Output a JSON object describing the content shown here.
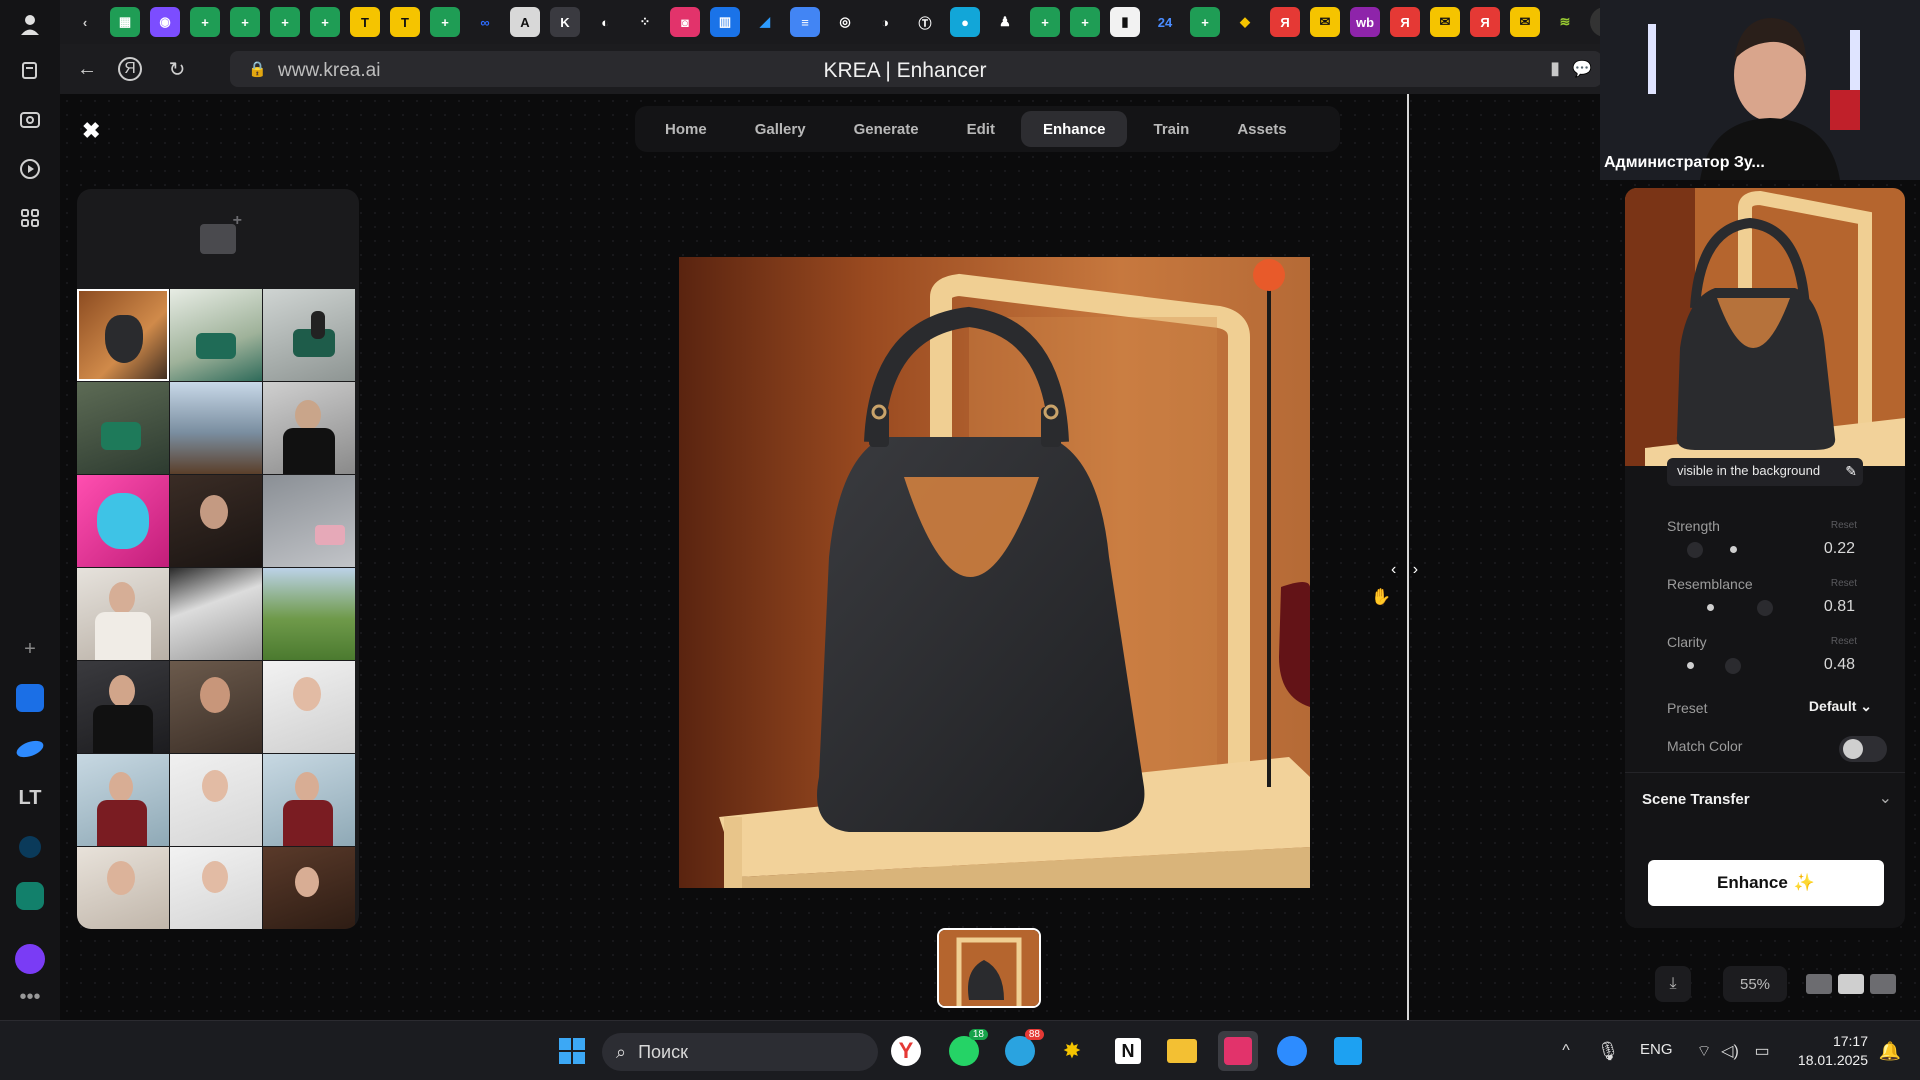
{
  "browser": {
    "url": "www.krea.ai",
    "page_title": "KREA | Enhancer"
  },
  "krea": {
    "nav": [
      "Home",
      "Gallery",
      "Generate",
      "Edit",
      "Enhance",
      "Train",
      "Assets"
    ],
    "active_nav": "Enhance"
  },
  "settings": {
    "prompt_snippet": "visible in the background",
    "reset_label": "Reset",
    "strength": {
      "label": "Strength",
      "value": "0.22"
    },
    "resemblance": {
      "label": "Resemblance",
      "value": "0.81"
    },
    "clarity": {
      "label": "Clarity",
      "value": "0.48"
    },
    "preset": {
      "label": "Preset",
      "value": "Default"
    },
    "match_color": {
      "label": "Match Color",
      "enabled": false
    },
    "scene_transfer": "Scene Transfer",
    "enhance_button": "Enhance"
  },
  "toolbar": {
    "zoom": "55%"
  },
  "webcam": {
    "name": "Администратор Зу..."
  },
  "taskbar": {
    "search_placeholder": "Поиск",
    "language": "ENG",
    "time": "17:17",
    "date": "18.01.2025",
    "whatsapp_badge": "18",
    "telegram_badge": "88"
  },
  "colors": {
    "accent_white": "#ffffff",
    "panel": "#141416",
    "bag": "#2a2b2e",
    "shelf": "#f2d29a",
    "background_wall": "#b5652e"
  }
}
